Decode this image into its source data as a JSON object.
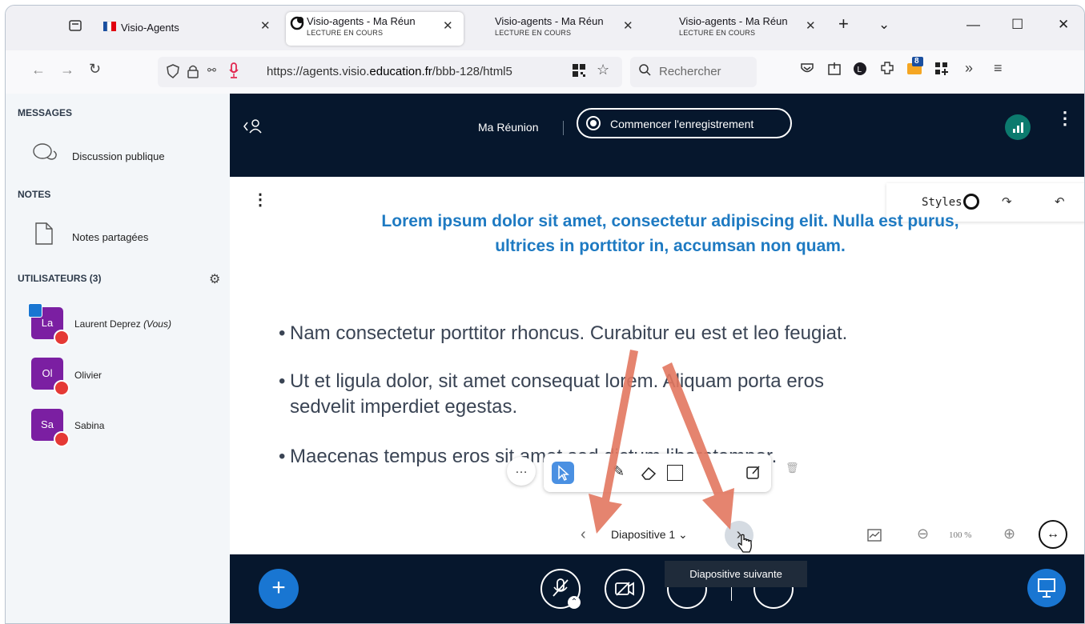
{
  "browser": {
    "tabs": [
      {
        "title": "Visio-Agents",
        "subtitle": ""
      },
      {
        "title": "Visio-agents - Ma Réun",
        "subtitle": "LECTURE EN COURS"
      },
      {
        "title": "Visio-agents - Ma Réun",
        "subtitle": "LECTURE EN COURS"
      },
      {
        "title": "Visio-agents - Ma Réun",
        "subtitle": "LECTURE EN COURS"
      }
    ],
    "url_prefix": "https://agents.visio.",
    "url_domain": "education.fr",
    "url_suffix": "/bbb-128/html5",
    "search_placeholder": "Rechercher",
    "ext_badge": "8"
  },
  "sidebar": {
    "messages_header": "MESSAGES",
    "public_chat": "Discussion publique",
    "notes_header": "NOTES",
    "shared_notes": "Notes partagées",
    "users_header": "UTILISATEURS (3)",
    "users": [
      {
        "initials": "La",
        "name": "Laurent Deprez",
        "suffix": "(Vous)"
      },
      {
        "initials": "Ol",
        "name": "Olivier",
        "suffix": ""
      },
      {
        "initials": "Sa",
        "name": "Sabina",
        "suffix": ""
      }
    ]
  },
  "meeting": {
    "name": "Ma Réunion",
    "record_label": "Commencer l'enregistrement"
  },
  "slide": {
    "title_line1": "Lorem ipsum dolor sit amet, consectetur adipiscing elit. Nulla est purus,",
    "title_line2": "ultrices in porttitor in, accumsan non quam.",
    "bullet1": "Nam consectetur porttitor rhoncus. Curabitur eu est et leo feugiat.",
    "bullet2_line1": "Ut et ligula dolor, sit amet consequat lorem. Aliquam porta eros",
    "bullet2_line2": "sedvelit imperdiet egestas.",
    "bullet3": "Maecenas tempus eros sit amet sed dictum liberotempor."
  },
  "whiteboard": {
    "styles_label": "Styles"
  },
  "slide_nav": {
    "current": "Diapositive 1",
    "zoom": "100 %"
  },
  "tooltip": "Diapositive suivante",
  "colors": {
    "dark_bg": "#06172d",
    "accent_blue": "#1e7ac2",
    "button_blue": "#1976d2",
    "avatar_purple": "#7b1fa2",
    "status_green": "#0c7a6e",
    "annotation_arrow": "#e2775f"
  }
}
